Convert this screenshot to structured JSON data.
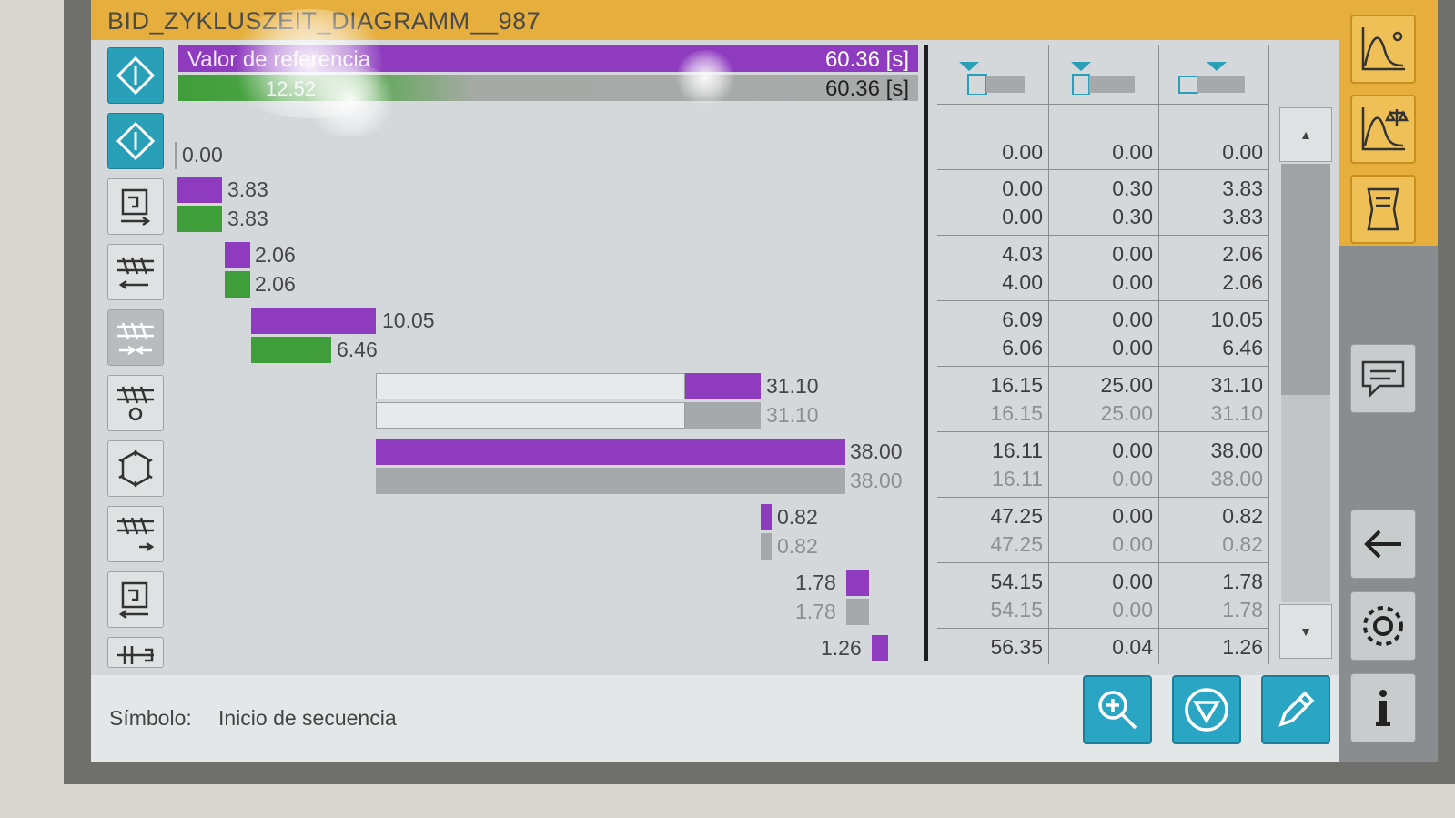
{
  "title": "BID_ZYKLUSZEIT_DIAGRAMM__987",
  "reference": {
    "purple_label": "Valor de referencia",
    "purple_value": "60.36 [s]",
    "gray_label": "12.52",
    "gray_value": "60.36 [s]"
  },
  "bars": [
    {
      "purple": "0.00",
      "secondary": ""
    },
    {
      "purple": "3.83",
      "secondary": "3.83"
    },
    {
      "purple": "2.06",
      "secondary": "2.06"
    },
    {
      "purple": "10.05",
      "secondary": "6.46"
    },
    {
      "purple": "31.10",
      "secondary": "31.10"
    },
    {
      "purple": "38.00",
      "secondary": "38.00"
    },
    {
      "purple": "0.82",
      "secondary": "0.82"
    },
    {
      "purple": "1.78",
      "secondary": "1.78"
    },
    {
      "purple": "1.26",
      "secondary": ""
    }
  ],
  "bar_fractions": {
    "note": "bar lengths shown by fill relative to 60.36 s reference"
  },
  "table": {
    "rows": [
      [
        [
          "0.00",
          "0.00",
          "0.00"
        ]
      ],
      [
        [
          "0.00",
          "0.30",
          "3.83"
        ],
        [
          "0.00",
          "0.30",
          "3.83"
        ]
      ],
      [
        [
          "4.03",
          "0.00",
          "2.06"
        ],
        [
          "4.00",
          "0.00",
          "2.06"
        ]
      ],
      [
        [
          "6.09",
          "0.00",
          "10.05"
        ],
        [
          "6.06",
          "0.00",
          "6.46"
        ]
      ],
      [
        [
          "16.15",
          "25.00",
          "31.10"
        ],
        [
          "16.15",
          "25.00",
          "31.10"
        ]
      ],
      [
        [
          "16.11",
          "0.00",
          "38.00"
        ],
        [
          "16.11",
          "0.00",
          "38.00"
        ]
      ],
      [
        [
          "47.25",
          "0.00",
          "0.82"
        ],
        [
          "47.25",
          "0.00",
          "0.82"
        ]
      ],
      [
        [
          "54.15",
          "0.00",
          "1.78"
        ],
        [
          "54.15",
          "0.00",
          "1.78"
        ]
      ],
      [
        [
          "56.35",
          "0.04",
          "1.26"
        ]
      ]
    ]
  },
  "status": {
    "label": "Símbolo:",
    "value": "Inicio de secuencia"
  },
  "colors": {
    "title_bar": "#e6ae3c",
    "purple": "#8e3bbf",
    "green": "#3f9e3a",
    "gray": "#a5a9ab",
    "teal_button": "#2aa6c4"
  },
  "icons": {
    "rail": [
      "curve-icon",
      "curve-balance-icon",
      "document-icon",
      "comment-icon",
      "back-arrow-icon",
      "settings-icon",
      "info-icon"
    ],
    "bottom": [
      "zoom-in-icon",
      "filter-icon",
      "edit-icon"
    ]
  }
}
